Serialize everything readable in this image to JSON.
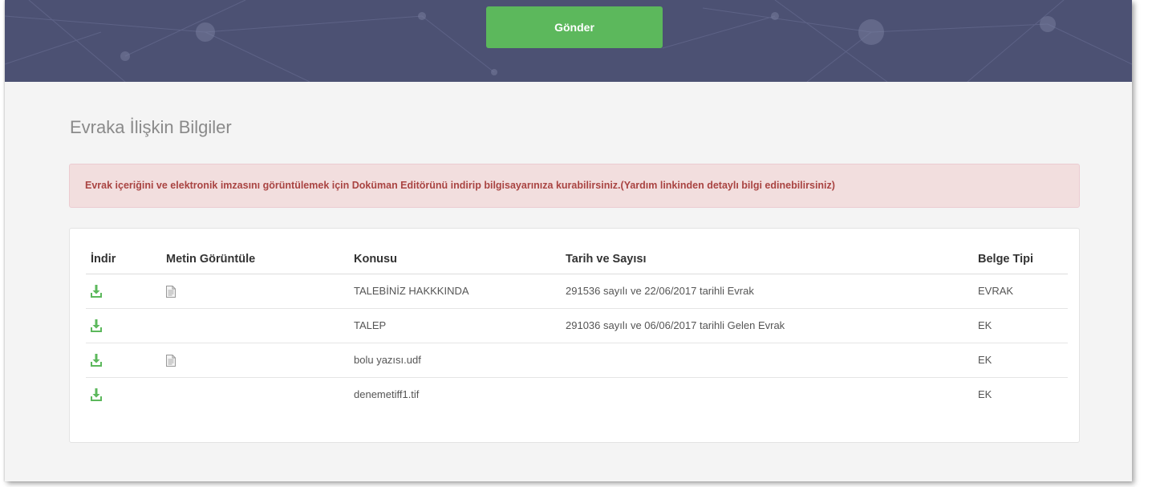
{
  "header": {
    "send_label": "Gönder"
  },
  "section": {
    "title": "Evraka İlişkin Bilgiler"
  },
  "alert": {
    "text": "Evrak içeriğini ve elektronik imzasını görüntülemek için Doküman Editörünü indirip bilgisayarınıza kurabilirsiniz.(Yardım linkinden detaylı bilgi edinebilirsiniz)"
  },
  "table": {
    "headers": [
      "İndir",
      "Metin Görüntüle",
      "Konusu",
      "Tarih ve Sayısı",
      "Belge Tipi"
    ],
    "rows": [
      {
        "download_icon": "download-icon",
        "view_icon": "document-icon",
        "subject": "TALEBİNİZ HAKKKINDA",
        "date_number": "291536 sayılı ve 22/06/2017 tarihli Evrak",
        "type": "EVRAK"
      },
      {
        "download_icon": "download-icon",
        "view_icon": "",
        "subject": "TALEP",
        "date_number": "291036 sayılı ve 06/06/2017 tarihli Gelen Evrak",
        "type": "EK"
      },
      {
        "download_icon": "download-icon",
        "view_icon": "document-icon",
        "subject": "bolu yazısı.udf",
        "date_number": "",
        "type": "EK"
      },
      {
        "download_icon": "download-icon",
        "view_icon": "",
        "subject": "denemetiff1.tif",
        "date_number": "",
        "type": "EK"
      }
    ]
  },
  "colors": {
    "banner": "#4c5173",
    "send_button": "#5cb85c",
    "alert_bg": "#f2dede",
    "alert_text": "#a94442",
    "download_icon": "#5cb85c"
  }
}
